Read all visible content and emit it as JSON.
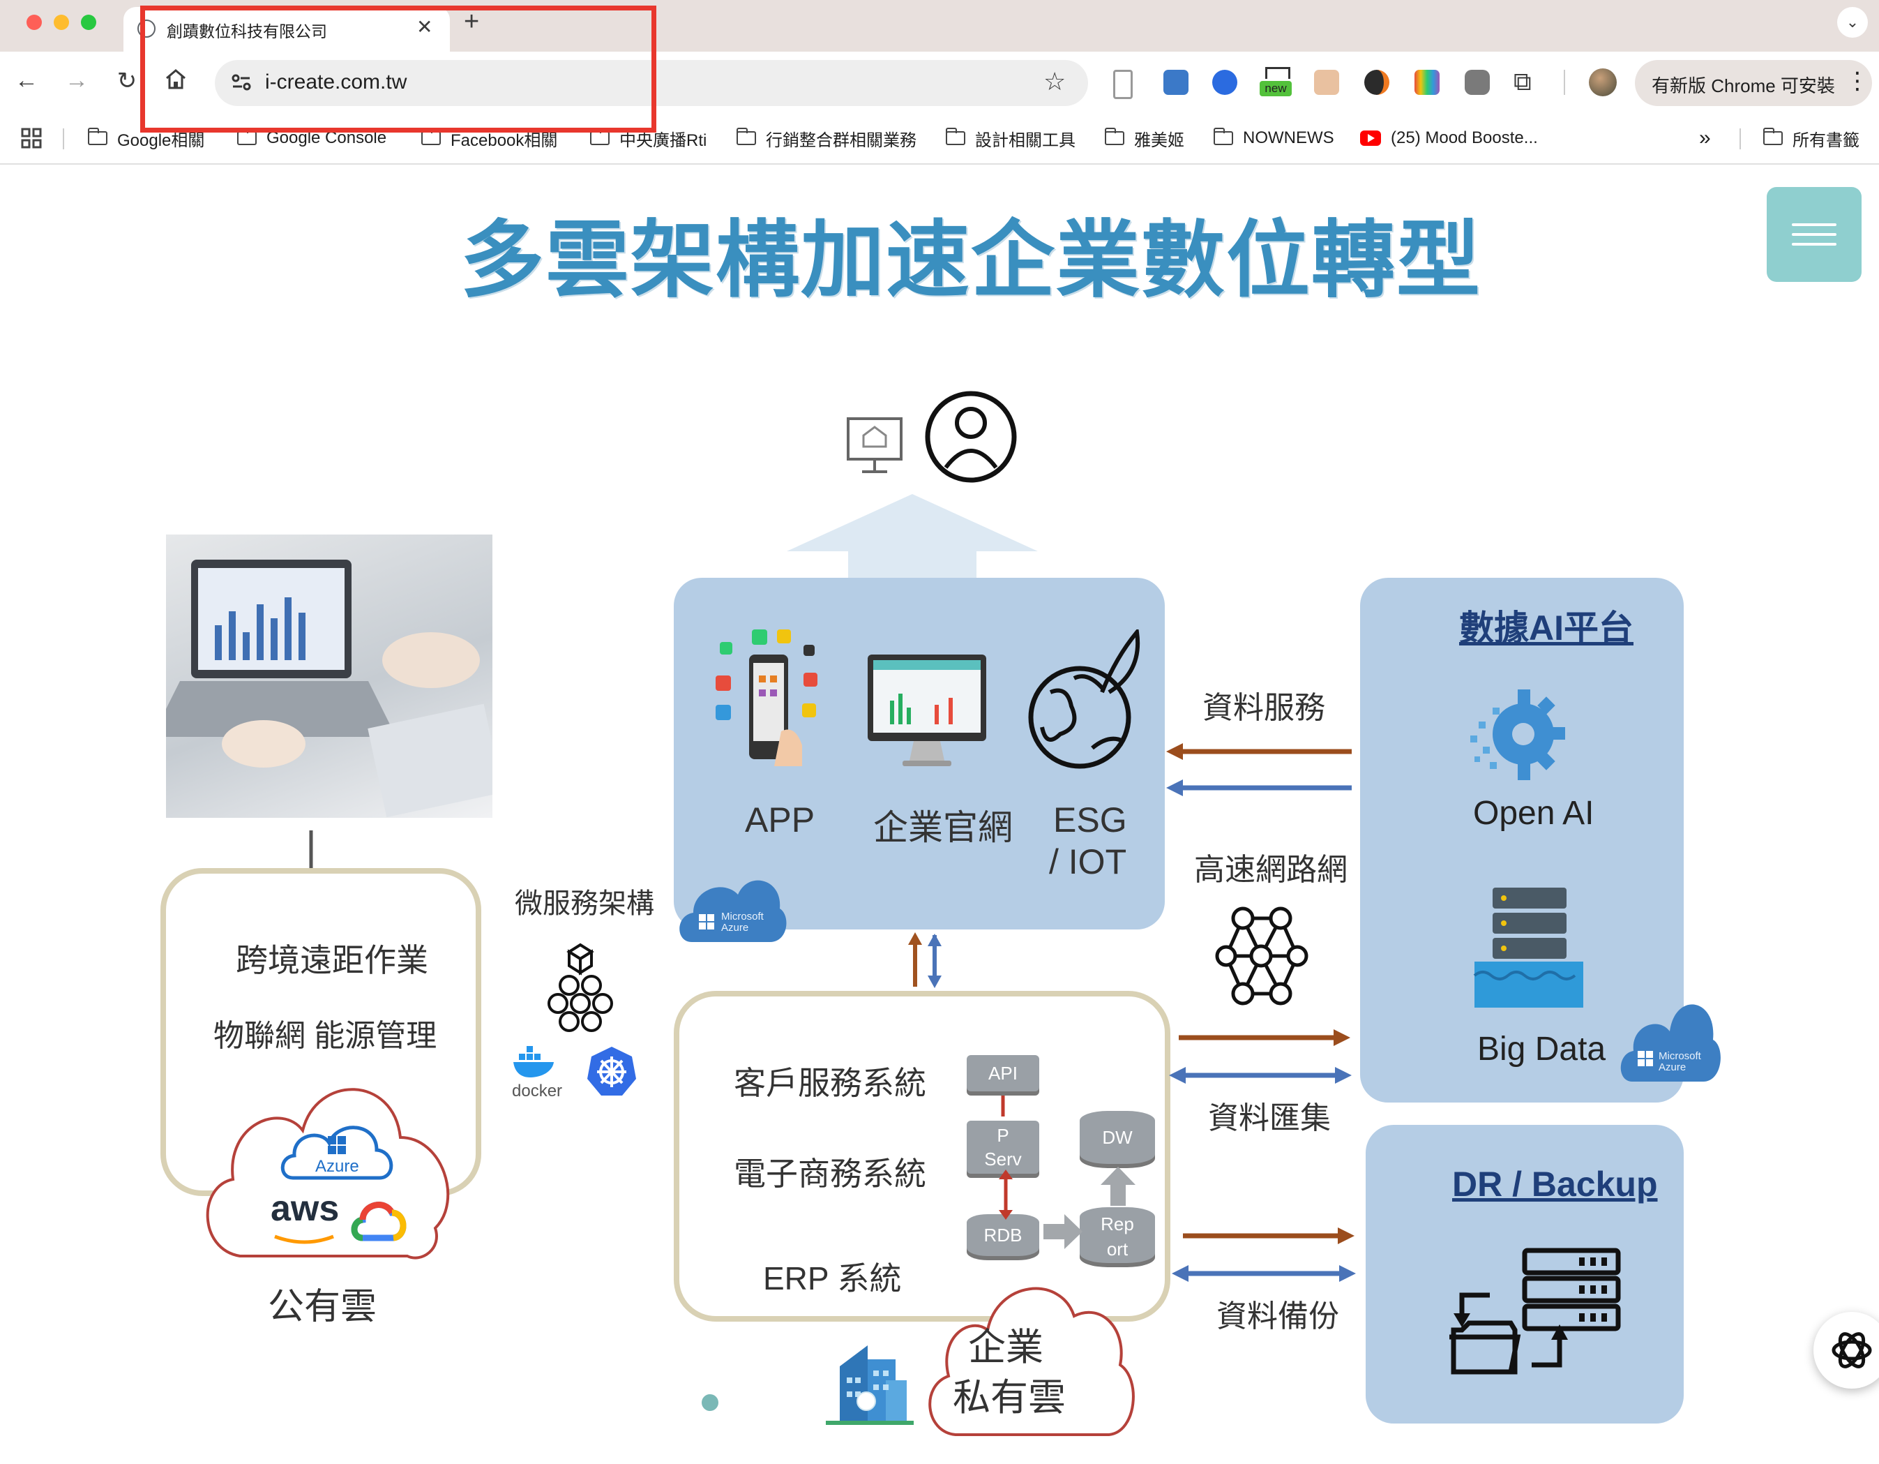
{
  "browser": {
    "tab_title": "創蹟數位科技有限公司",
    "url": "i-create.com.tw",
    "update_label": "有新版 Chrome 可安裝",
    "ext_new_badge": "new",
    "bookmarks": [
      {
        "label": "Google相關"
      },
      {
        "label": "Google Console"
      },
      {
        "label": "Facebook相關"
      },
      {
        "label": "中央廣播Rti"
      },
      {
        "label": "行銷整合群相關業務"
      },
      {
        "label": "設計相關工具"
      },
      {
        "label": "雅美姬"
      },
      {
        "label": "NOWNEWS"
      },
      {
        "label": "(25) Mood Booste..."
      }
    ],
    "more_bookmarks": "»",
    "all_bookmarks": "所有書籤",
    "colors": {
      "highlight_box": "#e8372d",
      "tabstrip": "#e8e0dd"
    }
  },
  "page": {
    "title": "多雲架構加速企業數位轉型",
    "colors": {
      "title": "#3a8fbf",
      "panel": "#b5cde5",
      "menu_button": "#8fcfcf"
    }
  },
  "diagram": {
    "public_cloud": {
      "remote_work": "跨境遠距作業",
      "iot_energy": "物聯網 能源管理",
      "azure": "Azure",
      "aws": "aws",
      "label": "公有雲"
    },
    "microservices": {
      "label": "微服務架構",
      "docker": "docker"
    },
    "apps_panel": {
      "app": "APP",
      "website": "企業官網",
      "esg_line1": "ESG",
      "esg_line2": "/ IOT",
      "azure_badge": "Microsoft Azure"
    },
    "private_cloud": {
      "customer_service": "客戶服務系統",
      "ecommerce": "電子商務系統",
      "erp": "ERP 系統",
      "api": "API",
      "app_serv_1": "P",
      "app_serv_2": "Serv",
      "rdb": "RDB",
      "dw": "DW",
      "report_1": "Rep",
      "report_2": "ort",
      "label_1": "企業",
      "label_2": "私有雲"
    },
    "connectors": {
      "data_service": "資料服務",
      "network": "高速網路網",
      "data_collect": "資料匯集",
      "data_backup": "資料備份"
    },
    "ai_platform": {
      "title": "數據AI平台",
      "open_ai": "Open AI",
      "big_data": "Big Data",
      "azure_badge": "Microsoft Azure"
    },
    "dr_backup": {
      "title": "DR / Backup"
    }
  }
}
